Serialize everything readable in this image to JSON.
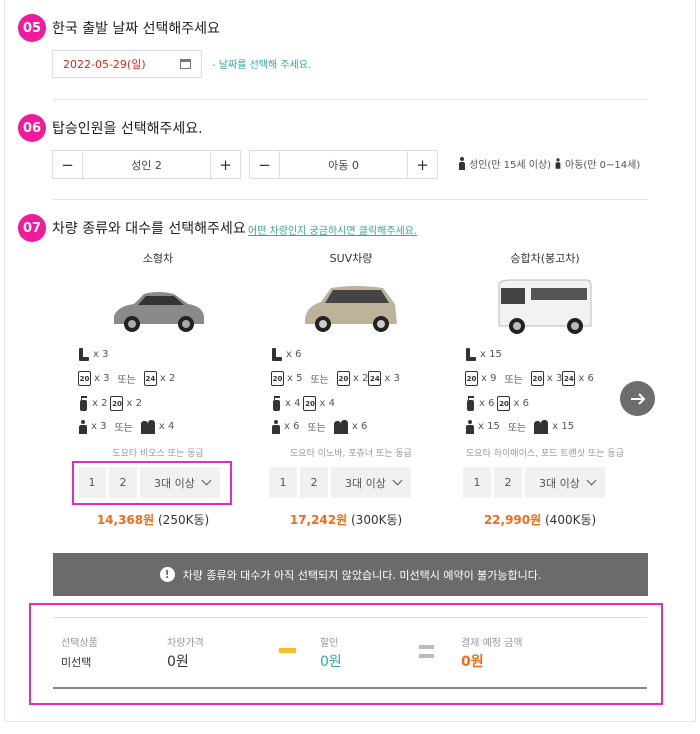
{
  "step05": {
    "num": "05",
    "title": "한국 출발 날짜 선택해주세요",
    "date_value": "2022-05-29(일)",
    "date_hint": "- 날짜를 선택해 주세요."
  },
  "step06": {
    "num": "06",
    "title": "탑승인원을 선택해주세요.",
    "adult": {
      "minus": "−",
      "value": "성인 2",
      "plus": "+"
    },
    "child": {
      "minus": "−",
      "value": "아동 0",
      "plus": "+"
    },
    "adult_note": "성인(만 15세 이상)",
    "child_note": "아동(만 0~14세)"
  },
  "step07": {
    "num": "07",
    "title": "차량 종류와 대수를 선택해주세요",
    "link": "어떤 차량인지 궁금하시면 클릭해주세요.",
    "or": "또는",
    "cars": [
      {
        "name": "소형차",
        "seats": "x 3",
        "lug20_a": "x 3",
        "lug20_b": "x 2",
        "lug24_b": "",
        "lug24_a": "x 2",
        "golf": "x 2",
        "golf_lug": "x 2",
        "people": "x 3",
        "family": "x 4",
        "model": "도요타 비오스 또는 동급",
        "qty": [
          "1",
          "2",
          "3대 이상"
        ],
        "price": "14,368원",
        "price_krw": "(250K동)"
      },
      {
        "name": "SUV차량",
        "seats": "x 6",
        "lug20_a": "x 5",
        "lug20_b": "x 2",
        "lug24_b": "x 3",
        "lug24_a": "",
        "golf": "x 4",
        "golf_lug": "x 4",
        "people": "x 6",
        "family": "x 6",
        "model": "도요타 이노바, 포츄너 또는 동급",
        "qty": [
          "1",
          "2",
          "3대 이상"
        ],
        "price": "17,242원",
        "price_krw": "(300K동)"
      },
      {
        "name": "승합차(봉고차)",
        "seats": "x 15",
        "lug20_a": "x 9",
        "lug20_b": "x 3",
        "lug24_b": "x 6",
        "lug24_a": "",
        "golf": "x 6",
        "golf_lug": "x 6",
        "people": "x 15",
        "family": "x 15",
        "model": "도요타 하이에이스, 포드 트랜싯 또는 동급",
        "qty": [
          "1",
          "2",
          "3대 이상"
        ],
        "price": "22,990원",
        "price_krw": "(400K동)"
      }
    ]
  },
  "warning": {
    "icon": "!",
    "text": "차량 종류와 대수가 아직 선택되지 않았습니다. 미선택시 예약이 불가능합니다."
  },
  "summary": {
    "product_label": "선택상품",
    "product_value": "미선택",
    "price_label": "차량가격",
    "price_value": "0원",
    "discount_label": "할인",
    "discount_value": "0원",
    "total_label": "결제 예정 금액",
    "total_value": "0원"
  },
  "colors": {
    "accent": "#f01a9a",
    "teal": "#3aa6a1",
    "orange": "#f26b1d",
    "highlight": "#e52cc2"
  }
}
